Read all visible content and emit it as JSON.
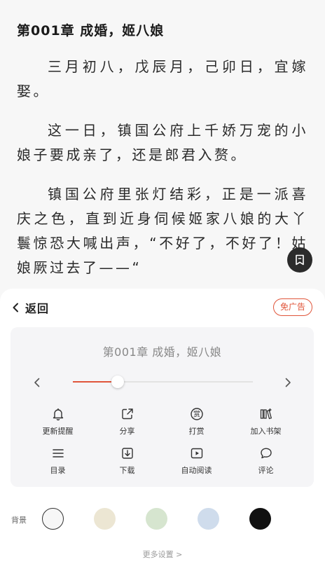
{
  "reader": {
    "chapter_title": "第001章 成婚，姬八娘",
    "paragraphs": [
      "三月初八，戊辰月，己卯日，宜嫁娶。",
      "这一日，镇国公府上千娇万宠的小娘子要成亲了，还是郎君入赘。",
      "镇国公府里张灯结彩，正是一派喜庆之色，直到近身伺候姬家八娘的大丫鬟惊恐大喊出声，“不好了，不好了！姑娘厥过去了——“"
    ]
  },
  "sheet": {
    "back_label": "返回",
    "adfree_label": "免广告",
    "chapter_name": "第001章 成婚，姬八娘",
    "progress_fraction": 0.25,
    "actions_row1": [
      {
        "label": "更新提醒",
        "icon": "bell-icon"
      },
      {
        "label": "分享",
        "icon": "share-icon"
      },
      {
        "label": "打赏",
        "icon": "reward-icon"
      },
      {
        "label": "加入书架",
        "icon": "bookshelf-icon"
      }
    ],
    "actions_row2": [
      {
        "label": "目录",
        "icon": "menu-icon"
      },
      {
        "label": "下载",
        "icon": "download-icon"
      },
      {
        "label": "自动阅读",
        "icon": "play-icon"
      },
      {
        "label": "评论",
        "icon": "comment-icon"
      }
    ],
    "background_label": "背景",
    "background_swatches": [
      "#f7f7f7",
      "#ece6d3",
      "#d6e5cf",
      "#cfdcec",
      "#111111"
    ],
    "selected_swatch": 0,
    "more_settings_label": "更多设置 >"
  },
  "colors": {
    "accent": "#e0553a",
    "panel_bg": "#f5f5f7",
    "fab_bg": "#2b2b2b"
  }
}
